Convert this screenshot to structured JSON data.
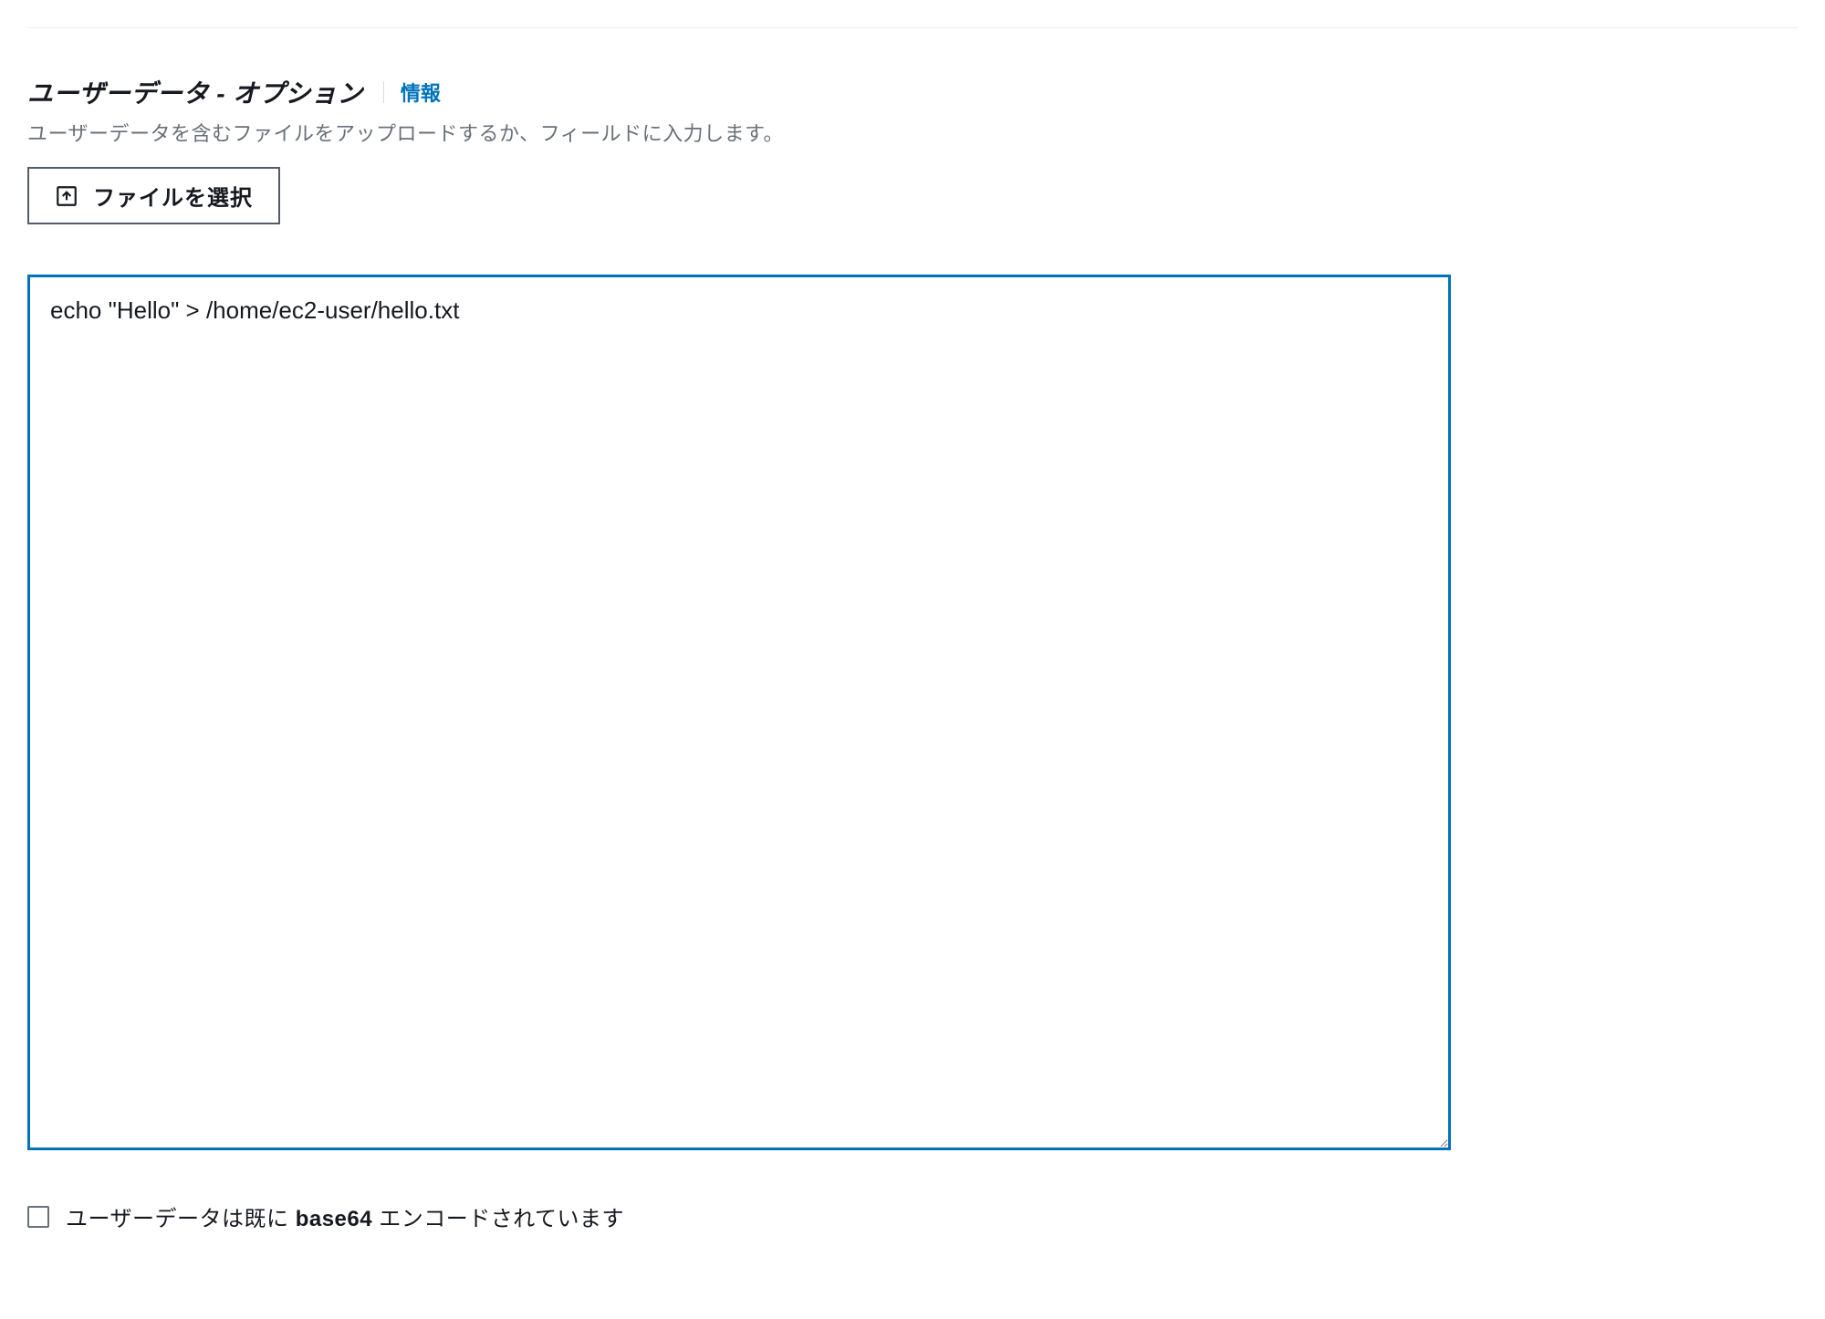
{
  "userdata": {
    "title": "ユーザーデータ - オプション",
    "info_label": "情報",
    "description": "ユーザーデータを含むファイルをアップロードするか、フィールドに入力します。",
    "file_select_label": "ファイルを選択",
    "textarea_value": "echo \"Hello\" > /home/ec2-user/hello.txt",
    "base64_checkbox_prefix": "ユーザーデータは既に ",
    "base64_checkbox_bold": "base64",
    "base64_checkbox_suffix": " エンコードされています",
    "base64_checked": false
  }
}
